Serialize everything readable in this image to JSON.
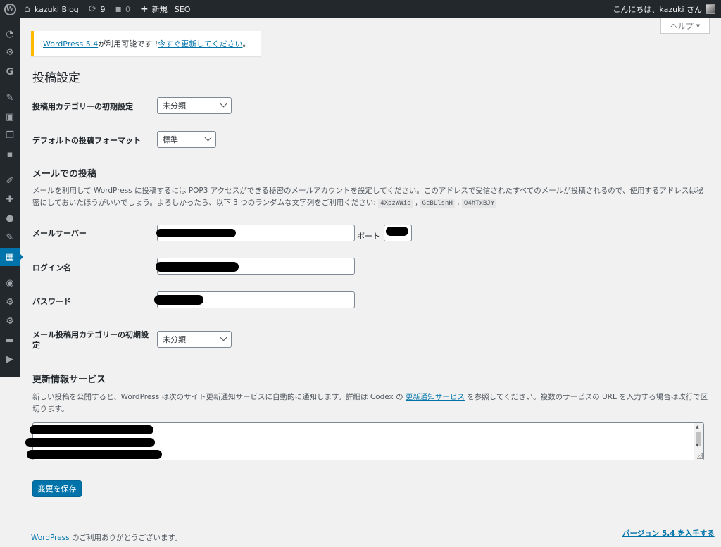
{
  "adminbar": {
    "site_name": "kazuki Blog",
    "updates_count": "9",
    "comments_count": "0",
    "new_label": "新規",
    "seo_label": "SEO",
    "greeting": "こんにちは、kazuki さん"
  },
  "help_tab": {
    "label": "ヘルプ",
    "arrow": "▼"
  },
  "notice": {
    "link1": "WordPress 5.4",
    "text1": " が利用可能です ! ",
    "link2": "今すぐ更新してください",
    "text2": "。"
  },
  "page": {
    "title": "投稿設定"
  },
  "settings": {
    "default_category_label": "投稿用カテゴリーの初期設定",
    "default_category_value": "未分類",
    "default_format_label": "デフォルトの投稿フォーマット",
    "default_format_value": "標準"
  },
  "email_post": {
    "title": "メールでの投稿",
    "description": "メールを利用して WordPress に投稿するには POP3 アクセスができる秘密のメールアカウントを設定してください。このアドレスで受信されたすべてのメールが投稿されるので、使用するアドレスは秘密にしておいたほうがいいでしょう。よろしかったら、以下 3 つのランダムな文字列をご利用ください: ",
    "random_strings": [
      "4XpzWWio",
      "GcBLlsnH",
      "O4hTxBJY"
    ],
    "mail_server_label": "メールサーバー",
    "port_label": "ポート",
    "login_label": "ログイン名",
    "password_label": "パスワード",
    "mail_category_label": "メール投稿用カテゴリーの初期設定",
    "mail_category_value": "未分類"
  },
  "update_services": {
    "title": "更新情報サービス",
    "desc_before": "新しい投稿を公開すると、WordPress は次のサイト更新通知サービスに自動的に通知します。詳細は Codex の ",
    "desc_link": "更新通知サービス",
    "desc_after": " を参照してください。複数のサービスの URL を入力する場合は改行で区切ります。"
  },
  "actions": {
    "save_label": "変更を保存"
  },
  "footer": {
    "link": "WordPress",
    "thanks": " のご利用ありがとうございます。",
    "version_link": "バージョン 5.4 を入手する"
  },
  "colors": {
    "adminbar_bg": "#23282d",
    "accent": "#0073aa",
    "notice_border": "#ffb900",
    "page_bg": "#f1f1f1"
  },
  "icons": {
    "adminbar": [
      "wordpress-logo-icon",
      "home-icon",
      "updates-icon",
      "comment-icon",
      "plus-icon"
    ],
    "sidebar": [
      "dashboard-icon",
      "gear-icon",
      "g-plugin-icon",
      "pin-icon",
      "media-icon",
      "pages-icon",
      "comments-icon",
      "appearance-icon",
      "plugins-icon",
      "users-icon",
      "tools-icon",
      "settings-icon",
      "wordpress-circle-icon",
      "gear-icon",
      "gear-icon",
      "camera-icon",
      "play-icon"
    ]
  }
}
